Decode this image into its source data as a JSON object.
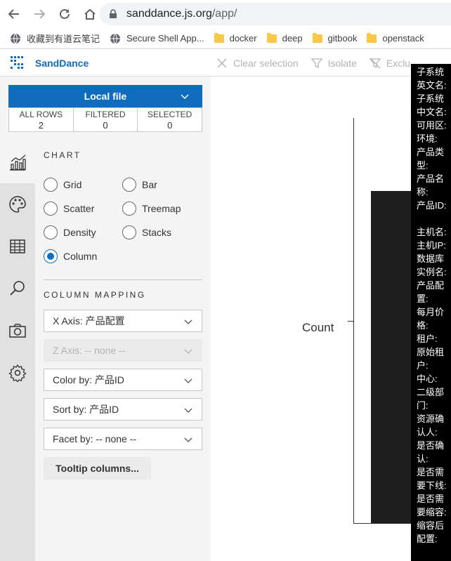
{
  "browser": {
    "url_host": "sanddance.js.org",
    "url_path": "/app/",
    "bookmarks": [
      {
        "label": "收藏到有道云笔记",
        "icon": "globe-icon"
      },
      {
        "label": "Secure Shell App...",
        "icon": "globe-icon"
      },
      {
        "label": "docker",
        "icon": "folder-icon"
      },
      {
        "label": "deep",
        "icon": "folder-icon"
      },
      {
        "label": "gitbook",
        "icon": "folder-icon"
      },
      {
        "label": "openstack",
        "icon": "folder-icon"
      }
    ]
  },
  "app": {
    "brand": "SandDance",
    "toolbar": {
      "clear_selection": "Clear selection",
      "isolate": "Isolate",
      "exclude": "Exclu"
    }
  },
  "panel": {
    "file_button": "Local file",
    "counts": [
      {
        "label": "ALL ROWS",
        "value": "2"
      },
      {
        "label": "FILTERED",
        "value": "0"
      },
      {
        "label": "SELECTED",
        "value": "0"
      }
    ],
    "chart_title": "CHART",
    "chart_types": [
      {
        "label": "Grid",
        "checked": false
      },
      {
        "label": "Bar",
        "checked": false
      },
      {
        "label": "Scatter",
        "checked": false
      },
      {
        "label": "Treemap",
        "checked": false
      },
      {
        "label": "Density",
        "checked": false
      },
      {
        "label": "Stacks",
        "checked": false
      },
      {
        "label": "Column",
        "checked": true
      }
    ],
    "mapping_title": "COLUMN MAPPING",
    "x_axis": "X Axis: 产品配置",
    "z_axis": "Z Axis: -- none --",
    "color_by": "Color by: 产品ID",
    "sort_by": "Sort by: 产品ID",
    "facet_by": "Facet by: -- none --",
    "tooltip_button": "Tooltip columns..."
  },
  "canvas": {
    "y_label": "Count"
  },
  "tooltip": {
    "lines": [
      "子系统",
      "英文名:",
      "子系统",
      "中文名:",
      "可用区:",
      "环境:",
      "产品类",
      "型:",
      "产品名",
      "称:",
      "产品ID:",
      "",
      "主机名:",
      "主机IP:",
      "数据库",
      "实例名:",
      "产品配",
      "置:",
      "每月价",
      "格:",
      "租户:",
      "原始租",
      "户:",
      "中心:",
      "二级部",
      "门:",
      "资源确",
      "认人:",
      "是否确",
      "认:",
      "是否需",
      "要下线:",
      "是否需",
      "要缩容:",
      "缩容后",
      "配置:"
    ]
  },
  "colors": {
    "accent": "#0f6cbd",
    "bar": "#1e1e1e"
  }
}
